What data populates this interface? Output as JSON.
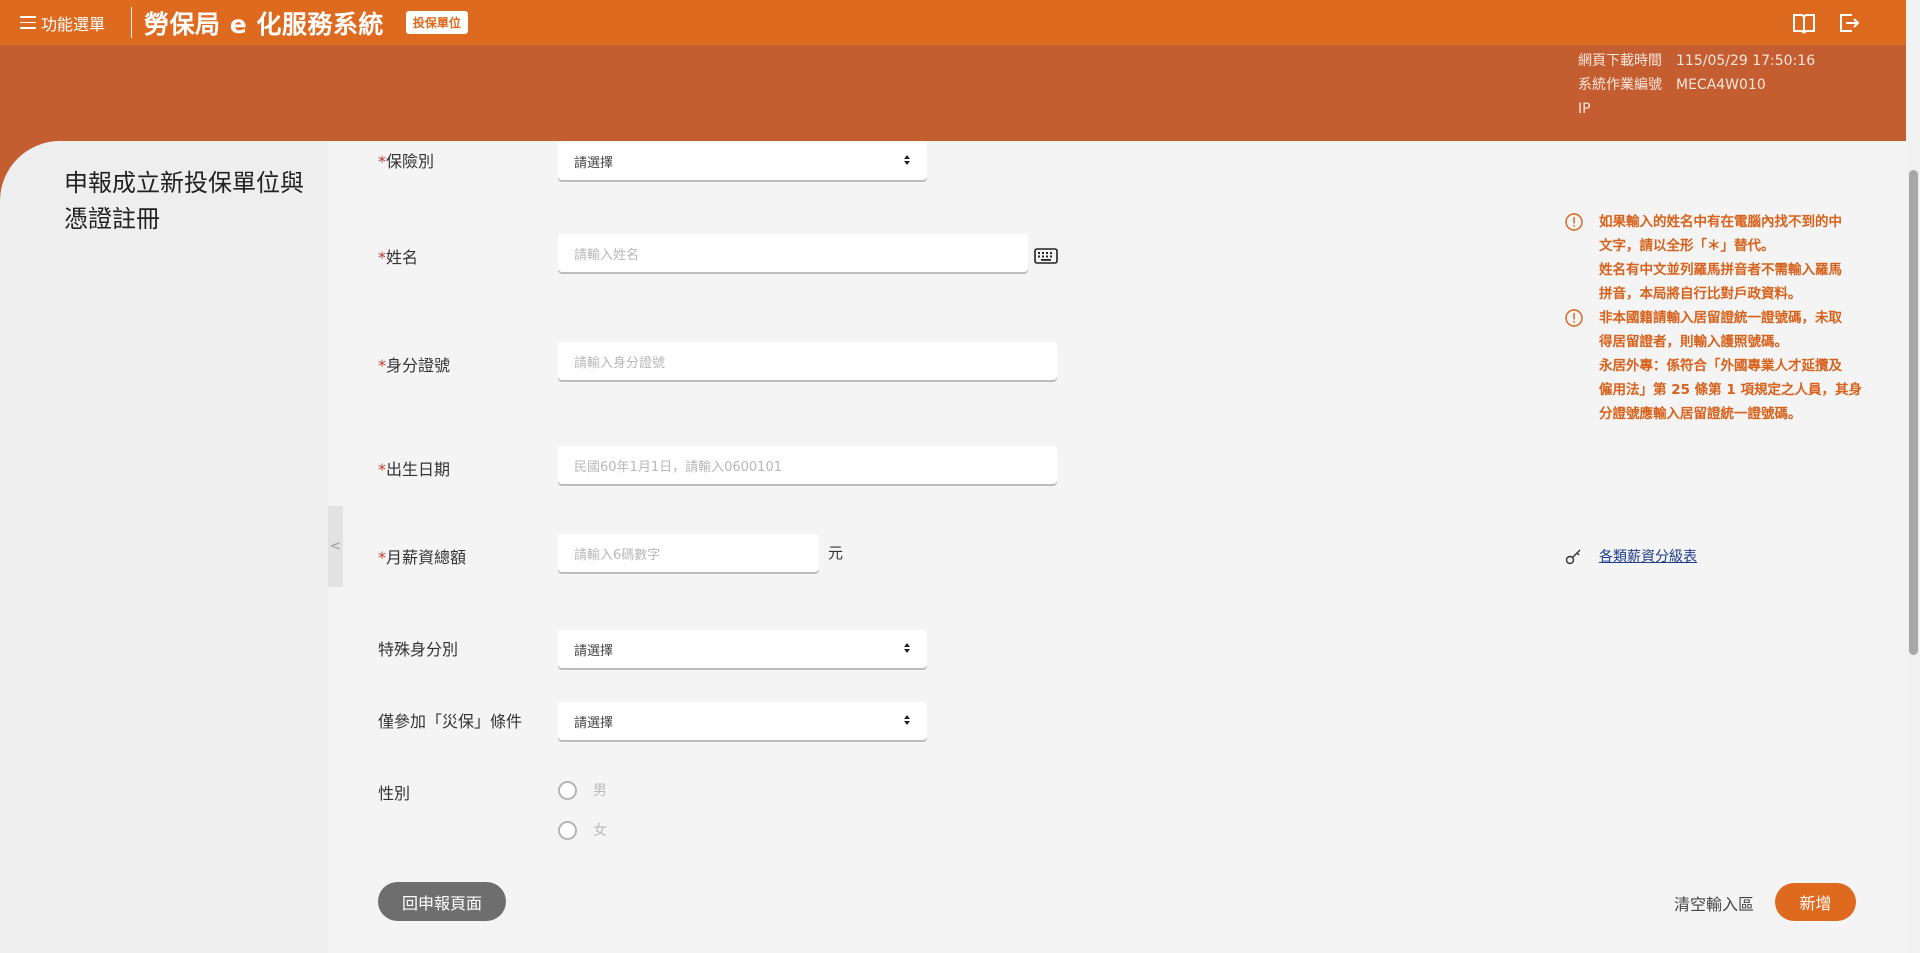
{
  "header": {
    "menu_label": "功能選單",
    "app_title": "勞保局 e 化服務系統",
    "unit_badge": "投保單位"
  },
  "meta": {
    "download_time_label": "網頁下載時間",
    "download_time_value": "115/05/29 17:50:16",
    "job_code_label": "系統作業編號",
    "job_code_value": "MECA4W010",
    "ip_label": "IP"
  },
  "page": {
    "heading": "申報成立新投保單位與憑證註冊",
    "collapse_glyph": "<"
  },
  "form": {
    "required_mark": "*",
    "insurance_type": {
      "label": "保險別",
      "value": "請選擇"
    },
    "name": {
      "label": "姓名",
      "placeholder": "請輸入姓名"
    },
    "id_number": {
      "label": "身分證號",
      "placeholder": "請輸入身分證號"
    },
    "birth_date": {
      "label": "出生日期",
      "placeholder": "民國60年1月1日，請輸入0600101"
    },
    "monthly_salary": {
      "label": "月薪資總額",
      "placeholder": "請輸入6碼數字",
      "unit": "元"
    },
    "special_identity": {
      "label": "特殊身分別",
      "value": "請選擇"
    },
    "disaster_only": {
      "label": "僅參加「災保」條件",
      "value": "請選擇"
    },
    "gender": {
      "label": "性別",
      "options": [
        "男",
        "女"
      ]
    }
  },
  "notes": {
    "note1_lines": [
      "如果輸入的姓名中有在電腦內找不到的中",
      "文字，請以全形「＊」替代。",
      "姓名有中文並列羅馬拼音者不需輸入羅馬",
      "拼音，本局將自行比對戶政資料。"
    ],
    "note2_lines": [
      "非本國籍請輸入居留證統一證號碼，未取",
      "得居留證者，則輸入護照號碼。",
      "永居外專：係符合「外國專業人才延攬及",
      "僱用法」第 25 條第 1 項規定之人員，其身",
      "分證號應輸入居留證統一證號碼。"
    ],
    "salary_table_link": "各類薪資分級表"
  },
  "buttons": {
    "back": "回申報頁面",
    "clear": "清空輸入區",
    "add": "新增"
  },
  "colors": {
    "brand_orange": "#dd6a1f",
    "header_band": "#c45e31",
    "note_orange": "#d7621c"
  }
}
